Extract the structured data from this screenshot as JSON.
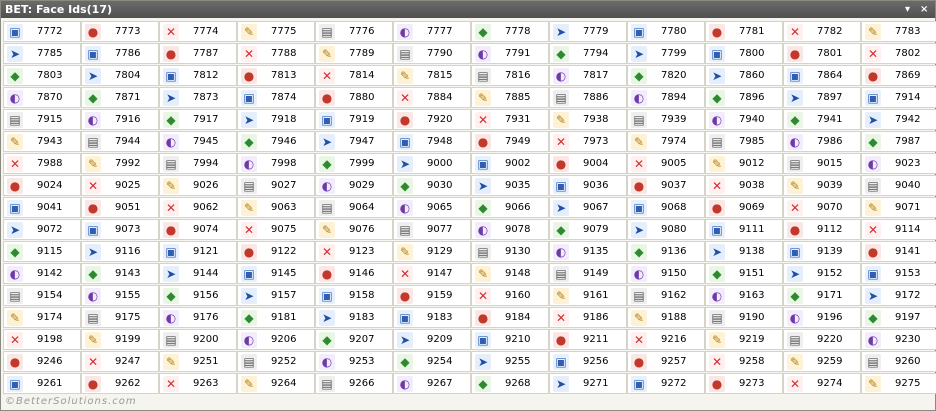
{
  "window": {
    "title": "BET: Face Ids(17)",
    "controls": {
      "dropdown": "▾",
      "close": "×"
    }
  },
  "rows": [
    [
      "7772",
      "7773",
      "7774",
      "7775",
      "7776",
      "7777",
      "7778",
      "7779",
      "7780",
      "7781",
      "7782",
      "7783"
    ],
    [
      "7785",
      "7786",
      "7787",
      "7788",
      "7789",
      "7790",
      "7791",
      "7794",
      "7799",
      "7800",
      "7801",
      "7802"
    ],
    [
      "7803",
      "7804",
      "7812",
      "7813",
      "7814",
      "7815",
      "7816",
      "7817",
      "7820",
      "7860",
      "7864",
      "7869"
    ],
    [
      "7870",
      "7871",
      "7873",
      "7874",
      "7880",
      "7884",
      "7885",
      "7886",
      "7894",
      "7896",
      "7897",
      "7914"
    ],
    [
      "7915",
      "7916",
      "7917",
      "7918",
      "7919",
      "7920",
      "7931",
      "7938",
      "7939",
      "7940",
      "7941",
      "7942"
    ],
    [
      "7943",
      "7944",
      "7945",
      "7946",
      "7947",
      "7948",
      "7949",
      "7973",
      "7974",
      "7985",
      "7986",
      "7987"
    ],
    [
      "7988",
      "7992",
      "7994",
      "7998",
      "7999",
      "9000",
      "9002",
      "9004",
      "9005",
      "9012",
      "9015",
      "9023"
    ],
    [
      "9024",
      "9025",
      "9026",
      "9027",
      "9029",
      "9030",
      "9035",
      "9036",
      "9037",
      "9038",
      "9039",
      "9040"
    ],
    [
      "9041",
      "9051",
      "9062",
      "9063",
      "9064",
      "9065",
      "9066",
      "9067",
      "9068",
      "9069",
      "9070",
      "9071"
    ],
    [
      "9072",
      "9073",
      "9074",
      "9075",
      "9076",
      "9077",
      "9078",
      "9079",
      "9080",
      "9111",
      "9112",
      "9114"
    ],
    [
      "9115",
      "9116",
      "9121",
      "9122",
      "9123",
      "9129",
      "9130",
      "9135",
      "9136",
      "9138",
      "9139",
      "9141"
    ],
    [
      "9142",
      "9143",
      "9144",
      "9145",
      "9146",
      "9147",
      "9148",
      "9149",
      "9150",
      "9151",
      "9152",
      "9153"
    ],
    [
      "9154",
      "9155",
      "9156",
      "9157",
      "9158",
      "9159",
      "9160",
      "9161",
      "9162",
      "9163",
      "9171",
      "9172"
    ],
    [
      "9174",
      "9175",
      "9176",
      "9181",
      "9183",
      "9183",
      "9184",
      "9186",
      "9188",
      "9190",
      "9196",
      "9197"
    ],
    [
      "9198",
      "9199",
      "9200",
      "9206",
      "9207",
      "9209",
      "9210",
      "9211",
      "9216",
      "9219",
      "9220",
      "9230"
    ],
    [
      "9246",
      "9247",
      "9251",
      "9252",
      "9253",
      "9254",
      "9255",
      "9256",
      "9257",
      "9258",
      "9259",
      "9260"
    ],
    [
      "9261",
      "9262",
      "9263",
      "9264",
      "9266",
      "9267",
      "9268",
      "9271",
      "9272",
      "9273",
      "9274",
      "9275"
    ]
  ],
  "footer": "©BetterSolutions.com"
}
